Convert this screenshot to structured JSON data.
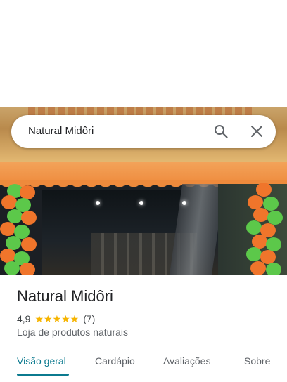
{
  "search": {
    "query": "Natural Midôri"
  },
  "place": {
    "name": "Natural Midôri",
    "rating": "4,9",
    "stars": "★★★★★",
    "review_count": "(7)",
    "category": "Loja de produtos naturais"
  },
  "tabs": [
    {
      "label": "Visão geral",
      "active": true
    },
    {
      "label": "Cardápio",
      "active": false
    },
    {
      "label": "Avaliações",
      "active": false
    },
    {
      "label": "Sobre",
      "active": false
    }
  ],
  "colors": {
    "accent": "#0b7a8f",
    "star": "#f6b400",
    "balloon_orange": "#f0752b",
    "balloon_green": "#5cc84a"
  },
  "icons": {
    "search": "search-icon",
    "close": "close-icon"
  }
}
